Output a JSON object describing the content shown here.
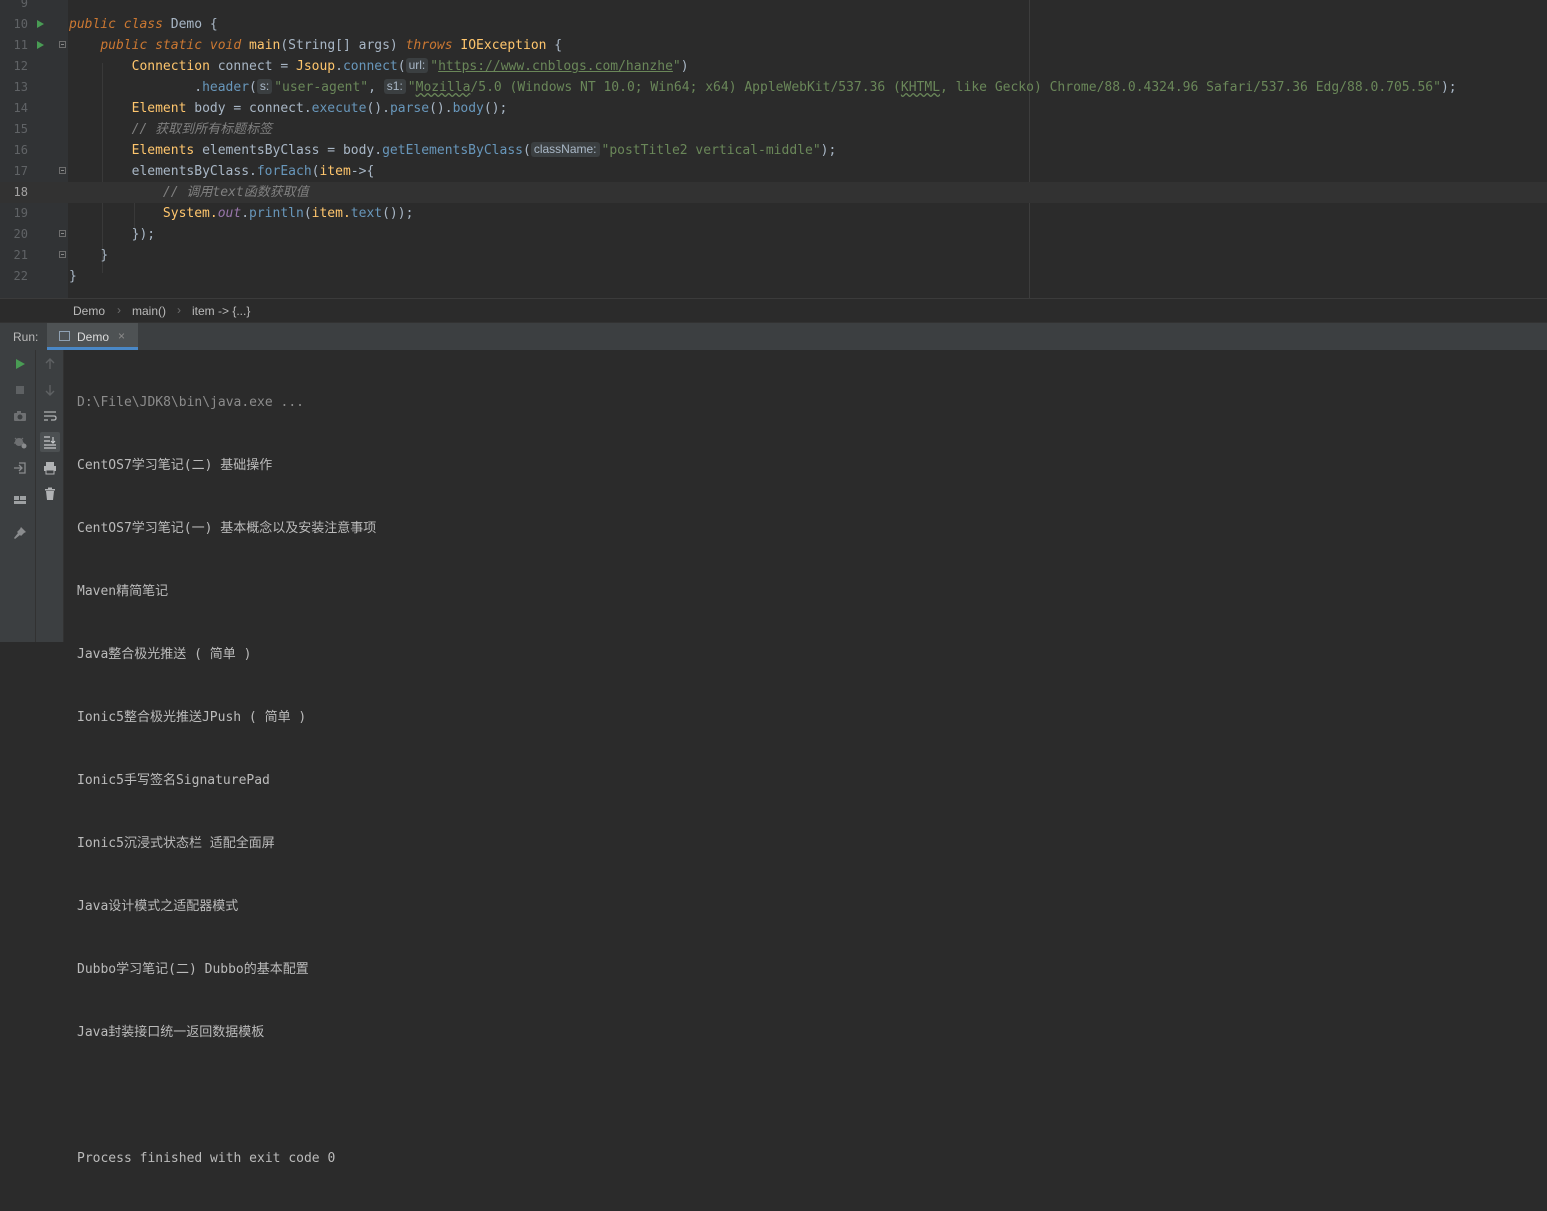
{
  "editor": {
    "line_numbers": [
      "9",
      "10",
      "11",
      "12",
      "13",
      "14",
      "15",
      "16",
      "17",
      "18",
      "19",
      "20",
      "21",
      "22"
    ],
    "lines": {
      "l10": {
        "public": "public",
        "class": "class",
        "name": "Demo",
        "brace": " {"
      },
      "l11": {
        "public": "public",
        "static": "static",
        "void": "void",
        "method": "main",
        "params": "(String[] args) ",
        "throws": "throws",
        "exc": "IOException",
        "brace": " {"
      },
      "l12": {
        "type": "Connection",
        "rest": " connect = ",
        "recv": "Jsoup",
        "dot": ".",
        "call": "connect",
        "open": "(",
        "hint": "url:",
        "q1": "\"",
        "url": "https://www.cnblogs.com/hanzhe",
        "q2": "\"",
        "close": ")"
      },
      "l13": {
        "dot": ".",
        "call": "header",
        "open": "(",
        "hint1": "s:",
        "str1": "\"user-agent\"",
        "comma": ", ",
        "hint2": "s1:",
        "q": "\"",
        "ua_a": "Mozilla",
        "ua_b": "/5.0 (Windows NT 10.0; Win64; x64) AppleWebKit/537.36 (",
        "ua_c": "KHTML",
        "ua_d": ", like Gecko) Chrome/88.0.4324.96 Safari/537.36 Edg/88.0.705.56\"",
        "end": ");"
      },
      "l14": {
        "type": "Element",
        "rest": " body = connect.",
        "c1": "execute",
        "p1": "().",
        "c2": "parse",
        "p2": "().",
        "c3": "body",
        "end": "();"
      },
      "l15": {
        "comment": "// 获取到所有标题标签"
      },
      "l16": {
        "type": "Elements",
        "rest": " elementsByClass = body.",
        "call": "getElementsByClass",
        "open": "(",
        "hint": "className:",
        "str": "\"postTitle2 vertical-middle\"",
        "end": ");"
      },
      "l17": {
        "recv": "elementsByClass.",
        "call": "forEach",
        "open": "(",
        "param": "item",
        "arrow": "->{"
      },
      "l18": {
        "comment": "// 调用text函数获取值"
      },
      "l19": {
        "recv": "System.",
        "field": "out",
        "dot": ".",
        "call": "println",
        "open": "(",
        "arg": "item.",
        "c2": "text",
        "end": "());"
      },
      "l20": {
        "text": "});"
      },
      "l21": {
        "text": "}"
      },
      "l22": {
        "text": "}"
      }
    }
  },
  "breadcrumb": {
    "items": [
      "Demo",
      "main()",
      "item -> {...}"
    ],
    "separator": "›"
  },
  "run_window": {
    "label": "Run:",
    "tab": {
      "label": "Demo",
      "close": "×"
    },
    "output": {
      "command": "D:\\File\\JDK8\\bin\\java.exe ...",
      "lines": [
        "CentOS7学习笔记(二) 基础操作",
        "CentOS7学习笔记(一) 基本概念以及安装注意事项",
        "Maven精简笔记",
        "Java整合极光推送 ( 简单 )",
        "Ionic5整合极光推送JPush ( 简单 )",
        "Ionic5手写签名SignaturePad",
        "Ionic5沉浸式状态栏 适配全面屏",
        "Java设计模式之适配器模式",
        "Dubbo学习笔记(二) Dubbo的基本配置",
        "Java封装接口统一返回数据模板",
        "",
        "Process finished with exit code 0"
      ]
    }
  },
  "icons": [
    "run-icon",
    "stop-icon",
    "camera-icon",
    "debug-settings-icon",
    "login-icon",
    "layout-icon",
    "pin-icon",
    "arrow-up-icon",
    "arrow-down-icon",
    "soft-wrap-icon",
    "scroll-to-end-icon",
    "print-icon",
    "trash-icon",
    "fold-icon",
    "run-gutter-icon",
    "console-icon"
  ],
  "colors": {
    "background": "#2b2b2b",
    "keyword": "#cc7832",
    "string": "#6a8759",
    "method": "#6897bb",
    "accent": "#4a88c7",
    "run_green": "#499c54"
  }
}
